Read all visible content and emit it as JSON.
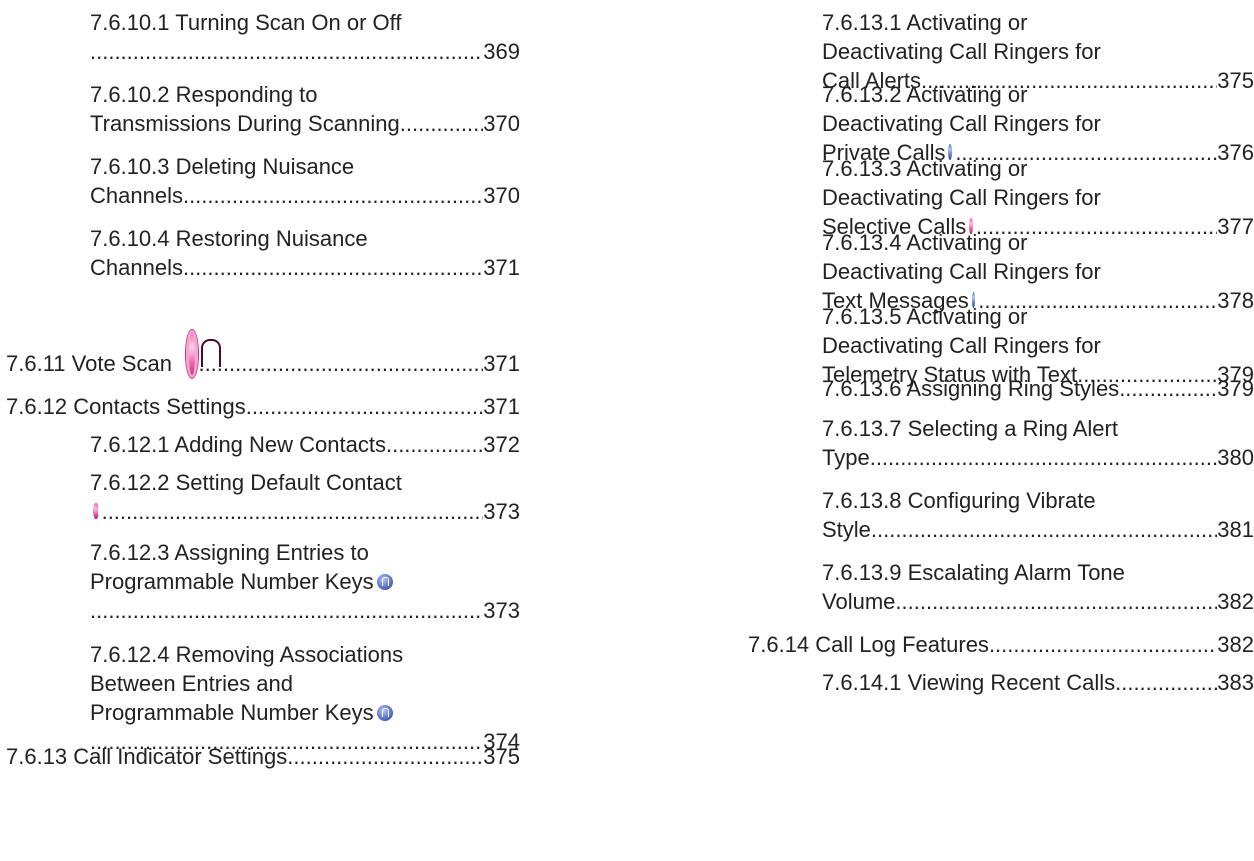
{
  "left_column": [
    {
      "level": 3,
      "lines": [
        "7.6.10.1 Turning Scan On or Off"
      ],
      "last": "",
      "page": "369"
    },
    {
      "level": 3,
      "lines": [
        "7.6.10.2 Responding to"
      ],
      "last": "Transmissions During Scanning",
      "page": "370"
    },
    {
      "level": 3,
      "lines": [
        "7.6.10.3 Deleting Nuisance"
      ],
      "last": "Channels",
      "page": "370"
    },
    {
      "level": 3,
      "lines": [
        "7.6.10.4 Restoring Nuisance"
      ],
      "last": "Channels",
      "page": "371"
    },
    {
      "level": 2,
      "lines": [],
      "last": "7.6.11 Vote Scan",
      "page": "371",
      "big_icon": "vote-scan-icon"
    },
    {
      "level": 2,
      "lines": [],
      "last": "7.6.12 Contacts Settings",
      "page": "371"
    },
    {
      "level": 3,
      "lines": [],
      "last": "7.6.12.1 Adding New Contacts",
      "page": "372"
    },
    {
      "level": 3,
      "lines": [
        "7.6.12.2 Setting Default Contact"
      ],
      "last": "",
      "page": "373",
      "icon": "pink"
    },
    {
      "level": 3,
      "lines": [
        "7.6.12.3 Assigning Entries to",
        "Programmable Number Keys"
      ],
      "line_icon": "blue",
      "last": "",
      "page": "373"
    },
    {
      "level": 3,
      "lines": [
        "7.6.12.4 Removing Associations",
        "Between Entries and",
        "Programmable Number Keys"
      ],
      "line_icon": "blue",
      "last": "",
      "page": "374"
    },
    {
      "level": 2,
      "lines": [],
      "last": "7.6.13 Call Indicator Settings",
      "page": "375"
    }
  ],
  "right_column": [
    {
      "level": 3,
      "lines": [
        "7.6.13.1 Activating or",
        "Deactivating Call Ringers for"
      ],
      "last": "Call Alerts",
      "page": "375"
    },
    {
      "level": 3,
      "lines": [
        "7.6.13.2 Activating or",
        "Deactivating Call Ringers for"
      ],
      "last": "Private Calls",
      "page": "376",
      "icon": "blue"
    },
    {
      "level": 3,
      "lines": [
        "7.6.13.3 Activating or",
        "Deactivating Call Ringers for"
      ],
      "last": "Selective Calls",
      "page": "377",
      "icon": "pink"
    },
    {
      "level": 3,
      "lines": [
        "7.6.13.4 Activating or",
        "Deactivating Call Ringers for"
      ],
      "last": "Text Messages",
      "page": "378",
      "icon": "blue"
    },
    {
      "level": 3,
      "lines": [
        "7.6.13.5 Activating or",
        "Deactivating Call Ringers for"
      ],
      "last": "Telemetry Status with Text",
      "page": "379"
    },
    {
      "level": 3,
      "lines": [],
      "last": "7.6.13.6 Assigning Ring Styles",
      "page": "379"
    },
    {
      "level": 3,
      "lines": [
        "7.6.13.7 Selecting a Ring Alert"
      ],
      "last": "Type",
      "page": "380"
    },
    {
      "level": 3,
      "lines": [
        "7.6.13.8 Configuring Vibrate"
      ],
      "last": "Style",
      "page": "381"
    },
    {
      "level": 3,
      "lines": [
        "7.6.13.9 Escalating Alarm Tone"
      ],
      "last": "Volume",
      "page": "382"
    },
    {
      "level": 2,
      "lines": [],
      "last": "7.6.14 Call Log Features",
      "page": "382"
    },
    {
      "level": 3,
      "lines": [],
      "last": "7.6.14.1 Viewing Recent Calls",
      "page": "383"
    }
  ]
}
